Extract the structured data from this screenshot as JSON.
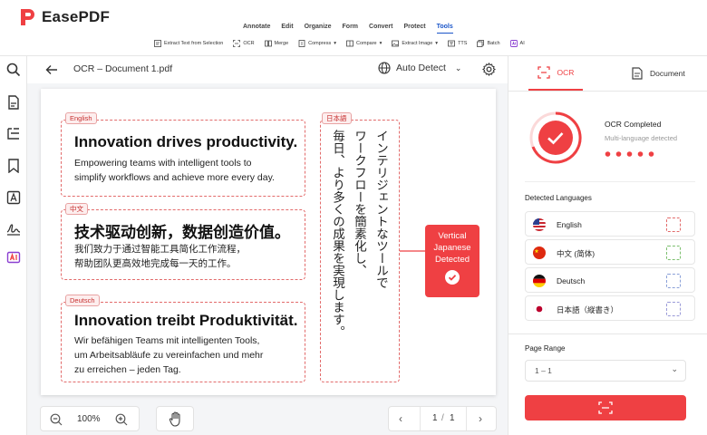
{
  "app": {
    "name": "EasePDF"
  },
  "menu": {
    "items": [
      "Annotate",
      "Edit",
      "Organize",
      "Form",
      "Convert",
      "Protect",
      "Tools"
    ],
    "active": "Tools"
  },
  "tools": {
    "extract_text": "Extract Text from Selection",
    "ocr": "OCR",
    "merge": "Merge",
    "compress": "Compress",
    "compare": "Compare",
    "extract_image": "Extract Image",
    "tts": "TTS",
    "batch": "Batch",
    "ai": "AI"
  },
  "doc": {
    "title": "OCR – Document 1.pdf",
    "detect": "Auto Detect"
  },
  "blocks": {
    "en": {
      "tag": "English",
      "title": "Innovation drives productivity.",
      "line1": "Empowering teams with intelligent tools to",
      "line2": "simplify workflows and achieve more every day."
    },
    "zh": {
      "tag": "中文",
      "title": "技术驱动创新，数据创造价值。",
      "line1": "我们致力于通过智能工具简化工作流程，",
      "line2": "帮助团队更高效地完成每一天的工作。"
    },
    "de": {
      "tag": "Deutsch",
      "title": "Innovation treibt Produktivität.",
      "line1": "Wir befähigen Teams mit intelligenten Tools,",
      "line2": "um Arbeitsabläufe zu vereinfachen und mehr",
      "line3": "zu erreichen – jeden Tag."
    },
    "ja": {
      "tag": "日本語",
      "col1": "インテリジェントなツールで",
      "col2": "ワークフローを簡素化し、",
      "col3": "毎日、より多くの成果を実現します。"
    }
  },
  "callout": {
    "line1": "Vertical",
    "line2": "Japanese",
    "line3": "Detected"
  },
  "zoom": {
    "value": "100%"
  },
  "pager": {
    "current": "1",
    "sep": "/",
    "total": "1"
  },
  "panel": {
    "tab_ocr": "OCR",
    "tab_document": "Document",
    "status_title": "OCR Completed",
    "status_sub": "Multi-language detected",
    "detected_label": "Detected Languages",
    "languages": [
      "English",
      "中文 (简体)",
      "Deutsch",
      "日本語（縦書き）"
    ],
    "page_range_label": "Page Range",
    "page_range_value": "1 – 1"
  },
  "colors": {
    "accent": "#ef4043",
    "brand_blue": "#1a55c9"
  }
}
